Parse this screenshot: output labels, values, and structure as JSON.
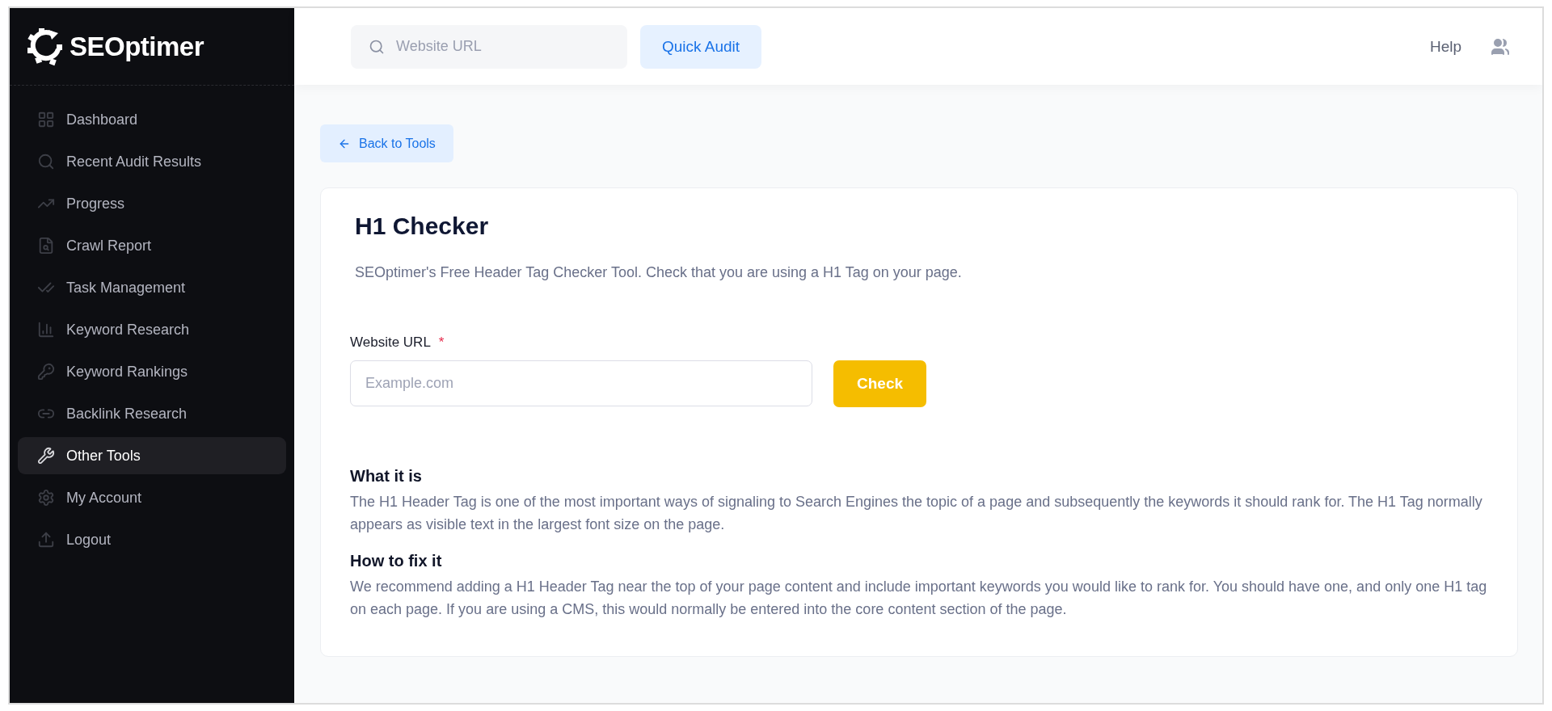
{
  "brand": {
    "name": "SEOptimer"
  },
  "sidebar": {
    "items": [
      {
        "label": "Dashboard",
        "selected": false
      },
      {
        "label": "Recent Audit Results",
        "selected": false
      },
      {
        "label": "Progress",
        "selected": false
      },
      {
        "label": "Crawl Report",
        "selected": false
      },
      {
        "label": "Task Management",
        "selected": false
      },
      {
        "label": "Keyword Research",
        "selected": false
      },
      {
        "label": "Keyword Rankings",
        "selected": false
      },
      {
        "label": "Backlink Research",
        "selected": false
      },
      {
        "label": "Other Tools",
        "selected": true
      },
      {
        "label": "My Account",
        "selected": false
      },
      {
        "label": "Logout",
        "selected": false
      }
    ]
  },
  "topbar": {
    "search": {
      "placeholder": "Website URL"
    },
    "quick_audit": "Quick Audit",
    "help": "Help"
  },
  "back_button": "Back to Tools",
  "card": {
    "title": "H1 Checker",
    "description": "SEOptimer's Free Header Tag Checker Tool. Check that you are using a H1 Tag on your page.",
    "form": {
      "label": "Website URL",
      "required_mark": "*",
      "placeholder": "Example.com",
      "button": "Check"
    },
    "sections": [
      {
        "heading": "What it is",
        "text": "The H1 Header Tag is one of the most important ways of signaling to Search Engines the topic of a page and subsequently the keywords it should rank for. The H1 Tag normally appears as visible text in the largest font size on the page."
      },
      {
        "heading": "How to fix it",
        "text": "We recommend adding a H1 Header Tag near the top of your page content and include important keywords you would like to rank for. You should have one, and only one H1 tag on each page. If you are using a CMS, this would normally be entered into the core content section of the page."
      }
    ]
  }
}
